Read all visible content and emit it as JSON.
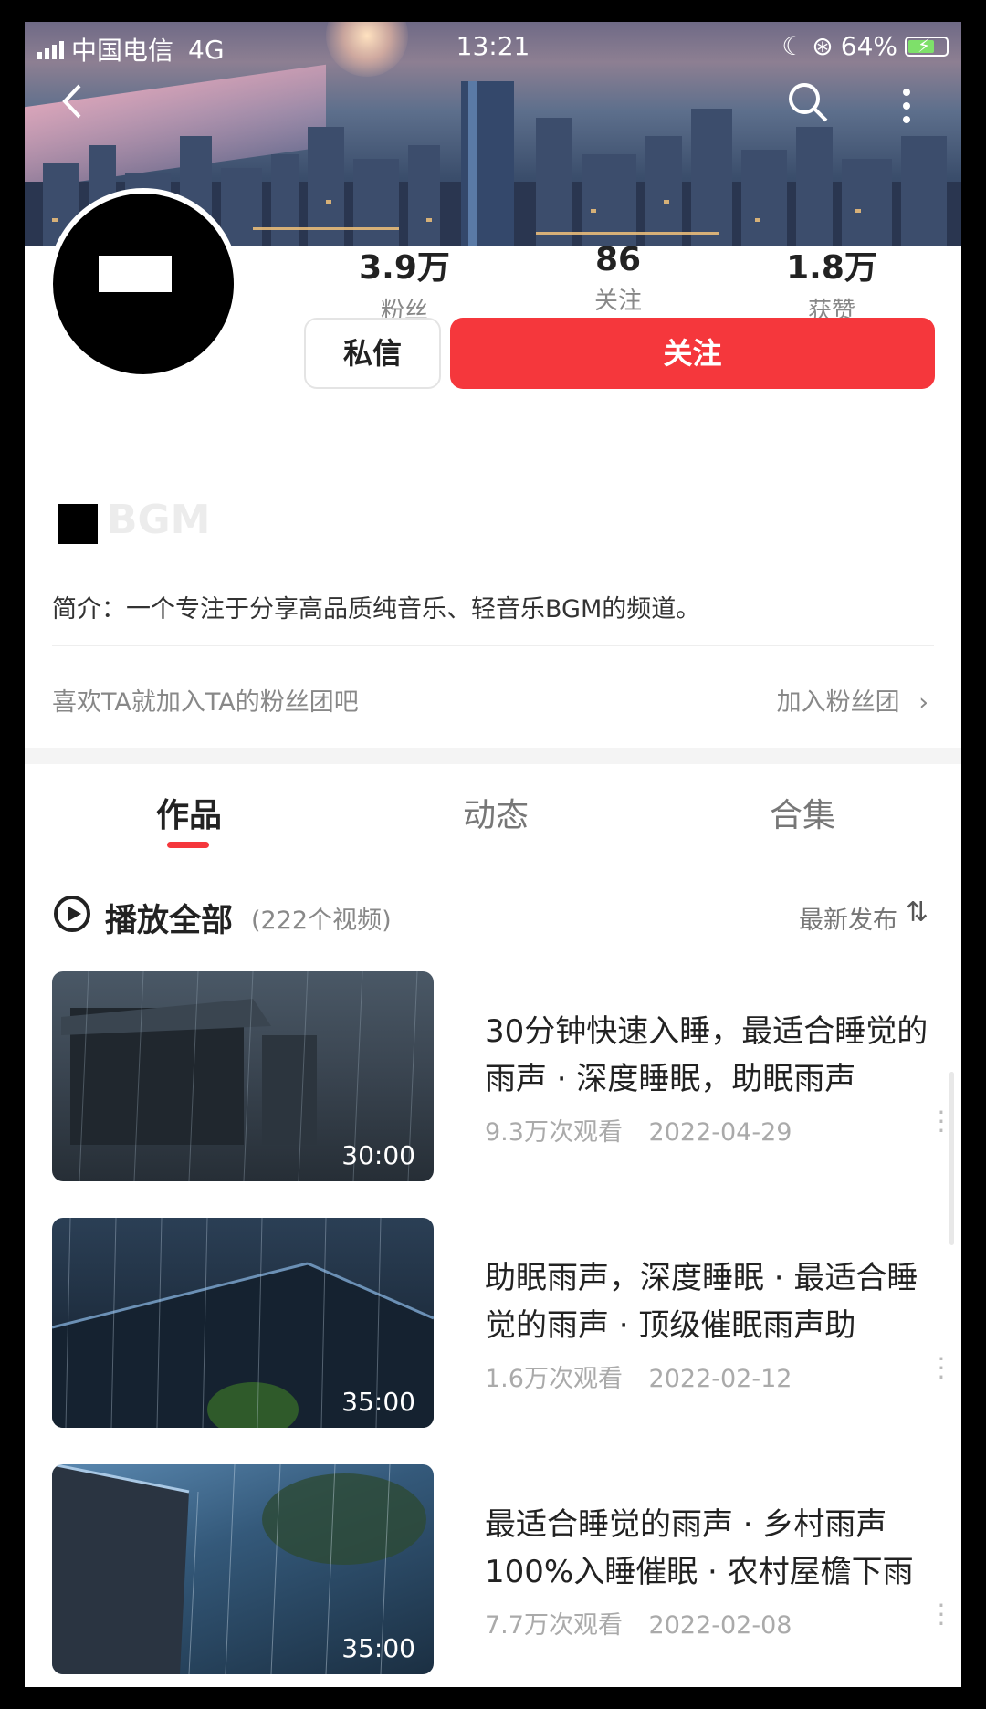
{
  "status_bar": {
    "carrier": "中国电信",
    "network": "4G",
    "time": "13:21",
    "battery": "64%",
    "battery_level": 0.64
  },
  "header": {
    "back_icon": "back-arrow-icon",
    "search_icon": "search-icon",
    "more_icon": "more-vertical-icon"
  },
  "profile": {
    "stats": [
      {
        "value": "3.9万",
        "label": "粉丝"
      },
      {
        "value": "86",
        "label": "关注"
      },
      {
        "value": "1.8万",
        "label": "获赞"
      }
    ],
    "message_label": "私信",
    "follow_label": "关注",
    "name_suffix": "BGM",
    "intro": "简介：一个专注于分享高品质纯音乐、轻音乐BGM的频道。",
    "fans_club_text": "喜欢TA就加入TA的粉丝团吧",
    "fans_club_join": "加入粉丝团"
  },
  "colors": {
    "accent": "#f5373c"
  },
  "tabs": [
    {
      "label": "作品",
      "active": true
    },
    {
      "label": "动态",
      "active": false
    },
    {
      "label": "合集",
      "active": false
    }
  ],
  "playlist": {
    "play_all": "播放全部",
    "count": "(222个视频)",
    "sort": "最新发布"
  },
  "videos": [
    {
      "title": "30分钟快速入睡，最适合睡觉的雨声 · 深度睡眠，助眠雨声",
      "views": "9.3万次观看",
      "date": "2022-04-29",
      "duration": "30:00"
    },
    {
      "title": "助眠雨声，深度睡眠 · 最适合睡觉的雨声 · 顶级催眠雨声助",
      "views": "1.6万次观看",
      "date": "2022-02-12",
      "duration": "35:00"
    },
    {
      "title": "最适合睡觉的雨声 · 乡村雨声100%入睡催眠 · 农村屋檐下雨",
      "views": "7.7万次观看",
      "date": "2022-02-08",
      "duration": "35:00"
    }
  ]
}
